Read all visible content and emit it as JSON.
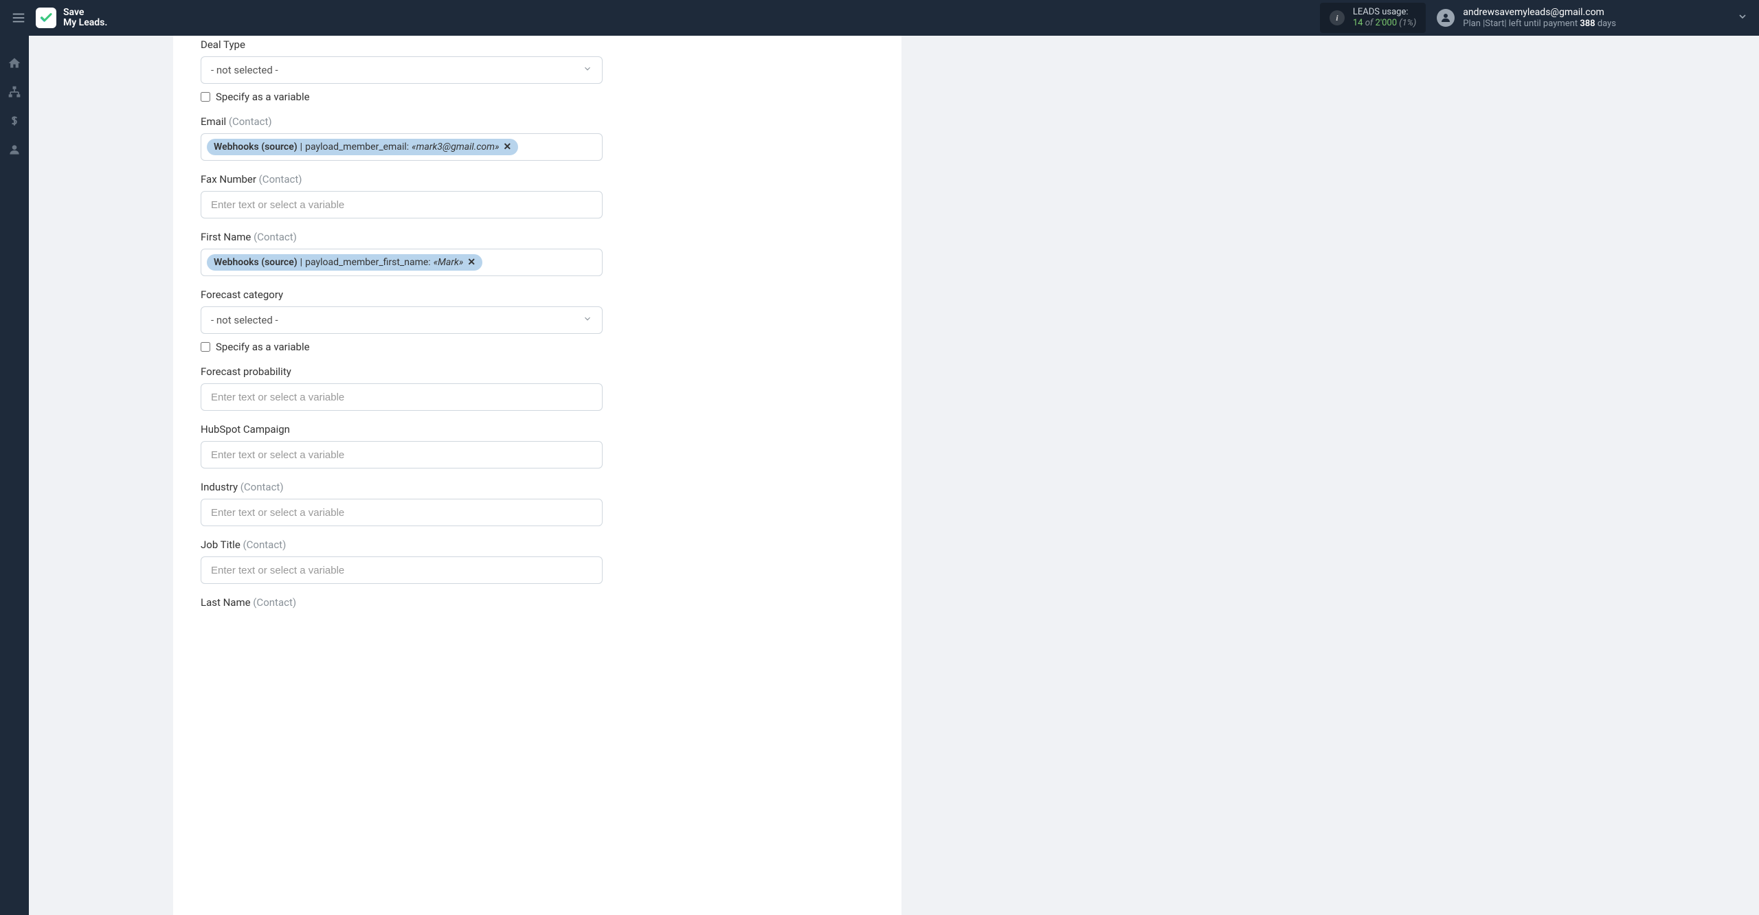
{
  "header": {
    "logo": {
      "line1": "Save",
      "line2": "My Leads."
    },
    "leads_usage": {
      "label": "LEADS usage:",
      "used": "14",
      "of_word": "of",
      "total": "2'000",
      "percent": "(1%)"
    },
    "user": {
      "email": "andrewsavemyleads@gmail.com",
      "plan_prefix": "Plan |Start| left until payment ",
      "plan_days": "388",
      "plan_suffix": " days"
    }
  },
  "form": {
    "deal_type": {
      "label": "Deal Type",
      "value": "- not selected -",
      "checkbox_label": "Specify as a variable"
    },
    "email": {
      "label": "Email ",
      "sublabel": "(Contact)",
      "tag_source": "Webhooks (source)",
      "tag_field": "payload_member_email:",
      "tag_value": "«mark3@gmail.com»"
    },
    "fax_number": {
      "label": "Fax Number ",
      "sublabel": "(Contact)",
      "placeholder": "Enter text or select a variable"
    },
    "first_name": {
      "label": "First Name ",
      "sublabel": "(Contact)",
      "tag_source": "Webhooks (source)",
      "tag_field": "payload_member_first_name:",
      "tag_value": "«Mark»"
    },
    "forecast_category": {
      "label": "Forecast category",
      "value": "- not selected -",
      "checkbox_label": "Specify as a variable"
    },
    "forecast_probability": {
      "label": "Forecast probability",
      "placeholder": "Enter text or select a variable"
    },
    "hubspot_campaign": {
      "label": "HubSpot Campaign",
      "placeholder": "Enter text or select a variable"
    },
    "industry": {
      "label": "Industry ",
      "sublabel": "(Contact)",
      "placeholder": "Enter text or select a variable"
    },
    "job_title": {
      "label": "Job Title ",
      "sublabel": "(Contact)",
      "placeholder": "Enter text or select a variable"
    },
    "last_name": {
      "label": "Last Name ",
      "sublabel": "(Contact)"
    }
  }
}
